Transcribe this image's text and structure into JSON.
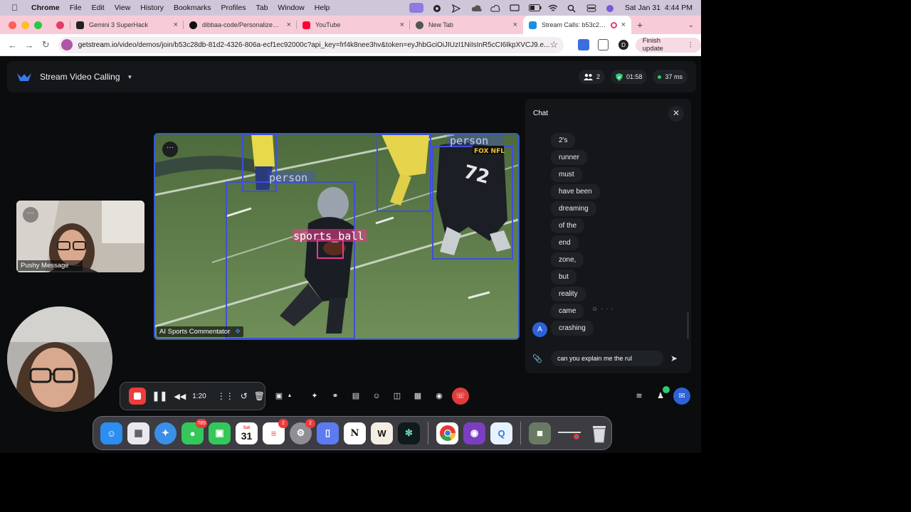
{
  "menubar": {
    "app": "Chrome",
    "items": [
      "File",
      "Edit",
      "View",
      "History",
      "Bookmarks",
      "Profiles",
      "Tab",
      "Window",
      "Help"
    ],
    "clock": "Sat Jan 31  4:44 PM"
  },
  "tabs": [
    {
      "title": "Gemini 3 SuperHack",
      "color": "#222222"
    },
    {
      "title": "dibbaa-code/PersonalizedCo",
      "color": "#111111"
    },
    {
      "title": "YouTube",
      "color": "#ff0033"
    },
    {
      "title": "New Tab",
      "color": "#555555"
    },
    {
      "title": "Stream Calls: b53c28db-",
      "color": "#1b8fe0"
    }
  ],
  "toolbar": {
    "url_host": "getstream.io",
    "url_rest": "/video/demos/join/b53c28db-81d2-4326-806a-ecf1ec92000c?api_key=frf4k8nee3hv&token=eyJhbGciOiJIUzI1NiIsInR5cCI6IkpXVCJ9.e...",
    "profile_initial": "D",
    "finish_update": "Finish update"
  },
  "app": {
    "title": "Stream Video Calling",
    "participants": "2",
    "duration": "01:58",
    "latency": "37 ms"
  },
  "main_video": {
    "name": "AI Sports Commentator",
    "labels": [
      "person",
      "person",
      "sports_ball"
    ],
    "broadcaster": "FOX NFL"
  },
  "participant_tile": {
    "name": "Pushy Message"
  },
  "chat": {
    "title": "Chat",
    "messages": [
      "2's",
      "runner",
      "must",
      "have been",
      "dreaming",
      "of the",
      "end",
      "zone,",
      "but",
      "reality",
      "came",
      "crashing"
    ],
    "avatar_initial": "A",
    "input_value": "can you explain me the rul"
  },
  "recorder": {
    "time": "1:20"
  },
  "dock": {
    "apps": [
      {
        "name": "Finder",
        "color": "#2b8ef0"
      },
      {
        "name": "Launchpad",
        "color": "#e8e8ee"
      },
      {
        "name": "Safari",
        "color": "#3a8fe8"
      },
      {
        "name": "Messages",
        "color": "#34c759",
        "badge": "785"
      },
      {
        "name": "FaceTime",
        "color": "#34c759"
      },
      {
        "name": "Calendar",
        "color": "#ffffff"
      },
      {
        "name": "Reminders",
        "color": "#ffffff",
        "badge": "2"
      },
      {
        "name": "System Settings",
        "color": "#8e8e93",
        "badge": "2"
      },
      {
        "name": "iPhone Mirroring",
        "color": "#5b7cf0"
      },
      {
        "name": "Notion",
        "color": "#ffffff"
      },
      {
        "name": "Warp",
        "color": "#f4eee2"
      },
      {
        "name": "Codex",
        "color": "#0f1a1a"
      },
      {
        "name": "Chrome",
        "color": "#ffffff"
      },
      {
        "name": "GitHub Desktop",
        "color": "#7a3fc0"
      },
      {
        "name": "QuickTime",
        "color": "#e8f2ff"
      }
    ],
    "calendar_day": "31",
    "calendar_month": "Sat"
  }
}
